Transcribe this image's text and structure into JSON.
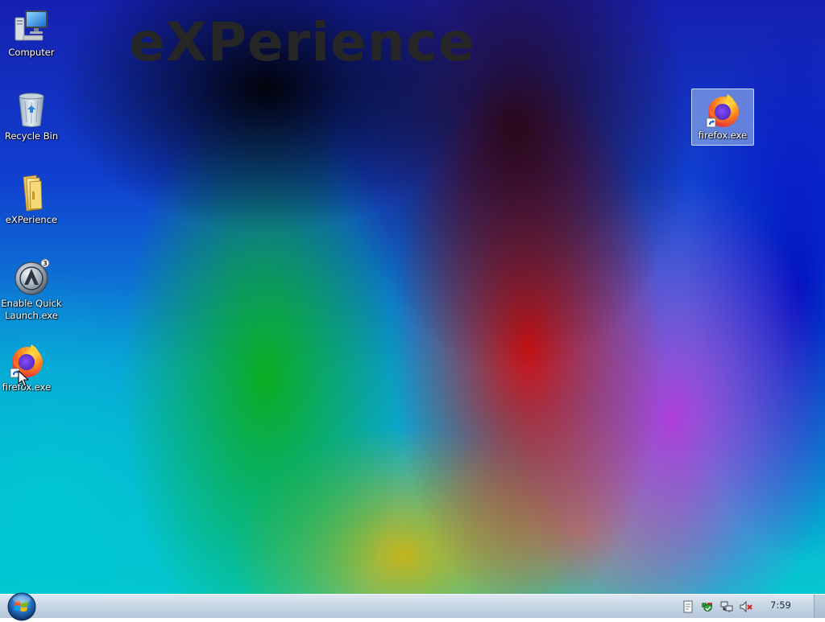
{
  "wallpaper": {
    "brand_text": "eXPerience"
  },
  "desktop_icons": [
    {
      "label": "Computer",
      "icon": "computer-icon"
    },
    {
      "label": "Recycle Bin",
      "icon": "recycle-bin-icon"
    },
    {
      "label": "eXPerience",
      "icon": "folder-icon"
    },
    {
      "label": "Enable Quick Launch.exe",
      "icon": "quick-launch-icon"
    },
    {
      "label": "firefox.exe",
      "icon": "firefox-icon",
      "shortcut": true
    },
    {
      "label": "firefox.exe",
      "icon": "firefox-icon",
      "shortcut": true,
      "selected": true
    }
  ],
  "taskbar": {
    "start_icon": "windows-orb-icon",
    "tray_icons": [
      "notes-icon",
      "security-icon",
      "network-icon",
      "volume-muted-icon"
    ],
    "clock": "7:59"
  },
  "colors": {
    "taskbar": "#c8d6e5",
    "selection": "#aac8f0",
    "icon_label": "#ffffff"
  }
}
